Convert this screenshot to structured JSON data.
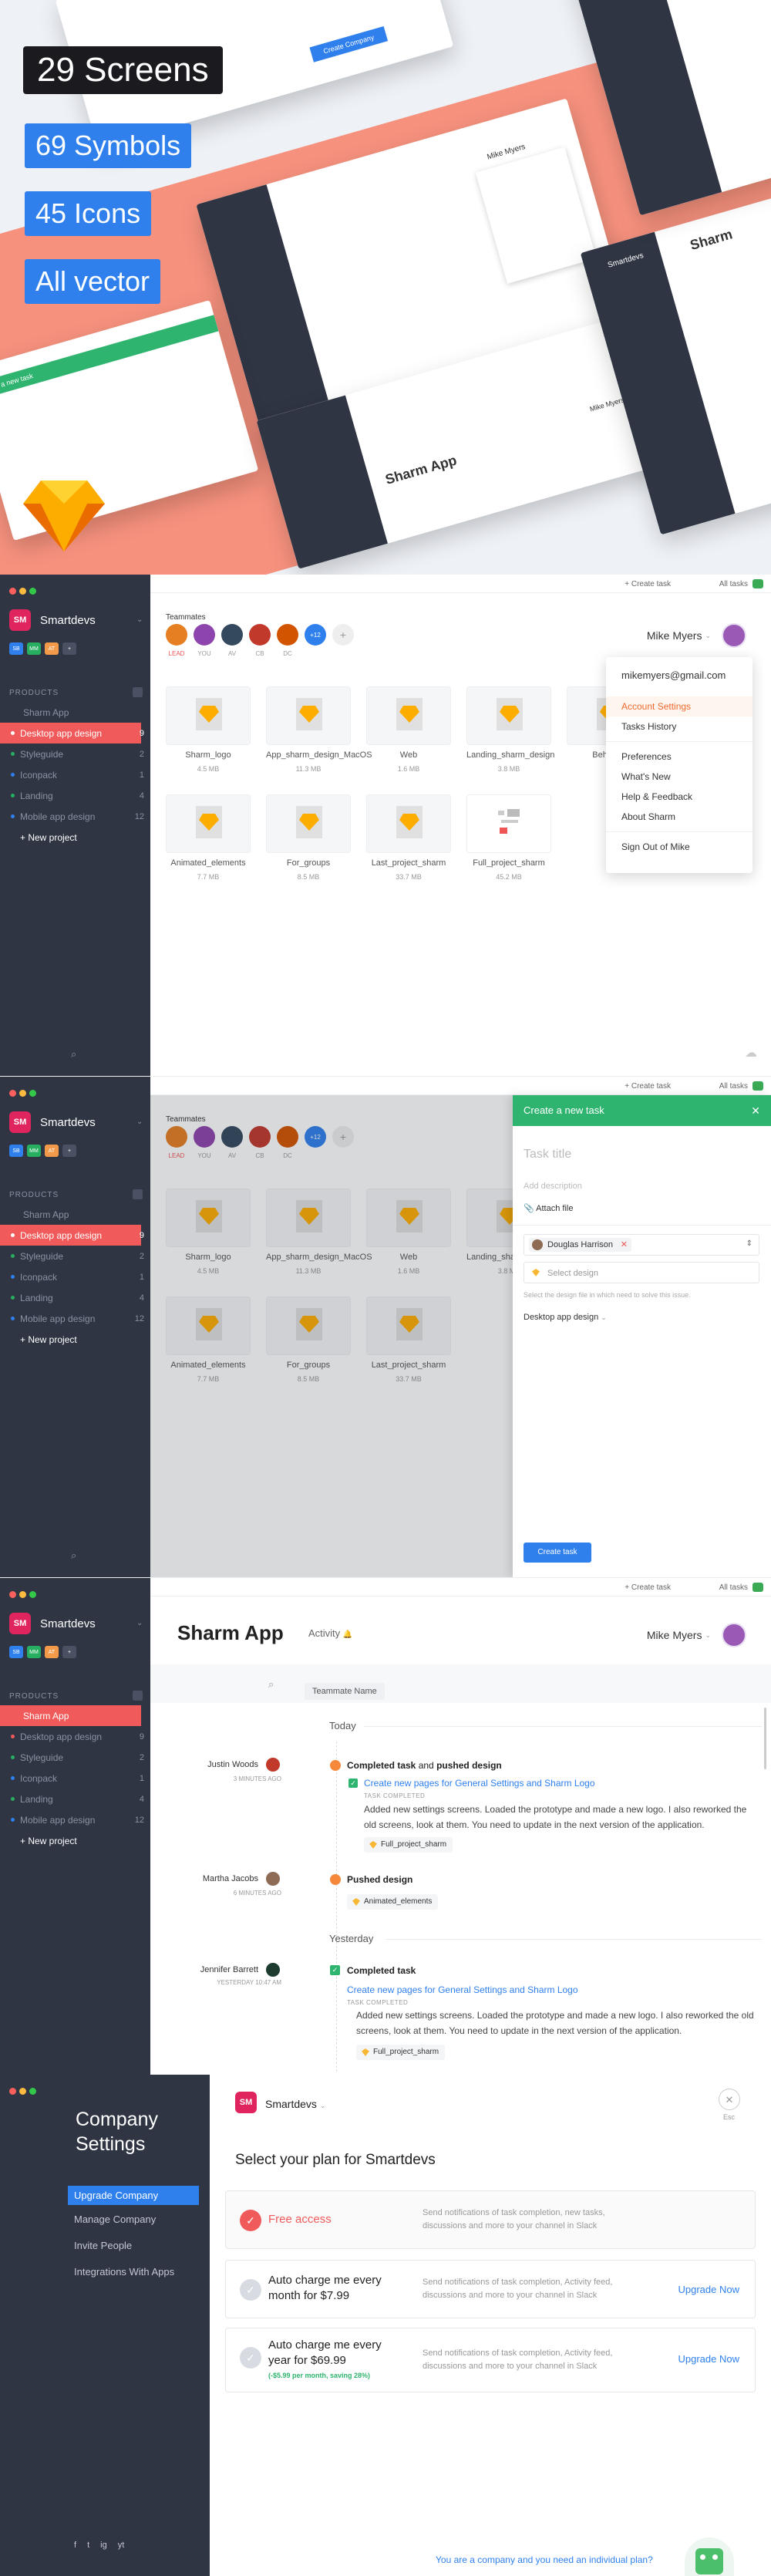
{
  "hero": {
    "screens": "29 Screens",
    "symbols": "69 Symbols",
    "icons": "45 Icons",
    "vector": "All vector",
    "mock_app": "Sharm App",
    "mock_user": "Mike Myers",
    "mock_ws": "Smartdevs",
    "mock_create": "Create Company",
    "mock_new": "Create a new task",
    "mock_sharm": "Sharm"
  },
  "app": {
    "workspace": "Smartdevs",
    "logo": "SM",
    "badges": [
      "SB",
      "MM",
      "AT",
      "+"
    ],
    "products_label": "PRODUCTS",
    "folder": "Sharm App",
    "items": [
      {
        "label": "Desktop app design",
        "count": "9"
      },
      {
        "label": "Styleguide",
        "count": "2"
      },
      {
        "label": "Iconpack",
        "count": "1"
      },
      {
        "label": "Landing",
        "count": "4"
      },
      {
        "label": "Mobile app design",
        "count": "12"
      }
    ],
    "new_project": "+ New project",
    "create_task": "+ Create task",
    "all_tasks": "All tasks",
    "all_tasks_count": "4",
    "teammates": "Teammates",
    "team": [
      {
        "label": "LEAD",
        "color": "#e67e22"
      },
      {
        "label": "YOU",
        "color": "#8e44ad"
      },
      {
        "label": "AV",
        "color": "#34495e"
      },
      {
        "label": "CB",
        "color": "#c0392b"
      },
      {
        "label": "DC",
        "color": "#d35400"
      },
      {
        "label": "+12",
        "color": "#2f80ed"
      }
    ],
    "user": "Mike Myers",
    "files": [
      {
        "name": "Sharm_logo",
        "size": "4.5 MB"
      },
      {
        "name": "App_sharm_design_MacOS",
        "size": "11.3 MB"
      },
      {
        "name": "Web",
        "size": "1.6 MB"
      },
      {
        "name": "Landing_sharm_design",
        "size": "3.8 MB"
      },
      {
        "name": "Behance",
        "size": ""
      },
      {
        "name": "Animated_elements",
        "size": "7.7 MB"
      },
      {
        "name": "For_groups",
        "size": "8.5 MB"
      },
      {
        "name": "Last_project_sharm",
        "size": "33.7 MB"
      },
      {
        "name": "Full_project_sharm",
        "size": "45.2 MB"
      }
    ],
    "sketch_label": "SKETCH",
    "menu": {
      "email": "mikemyers@gmail.com",
      "items": [
        "Account Settings",
        "Tasks History",
        "Preferences",
        "What's New",
        "Help & Feedback",
        "About Sharm",
        "Sign Out of Mike"
      ]
    }
  },
  "task_modal": {
    "title": "Create a new task",
    "task_title_ph": "Task title",
    "desc_ph": "Add description",
    "attach": "Attach file",
    "assignee": "Douglas Harrison",
    "select_design": "Select design",
    "hint": "Select the design file in which need to solve this issue.",
    "project": "Desktop app design",
    "create": "Create task"
  },
  "activity": {
    "app_title": "Sharm App",
    "tab": "Activity",
    "teammate_filter": "Teammate Name",
    "today": "Today",
    "yesterday": "Yesterday",
    "e1_who": "Justin Woods",
    "e1_ago": "3 MINUTES AGO",
    "e1_action": "Completed task",
    "e1_and": "and",
    "e1_action2": "pushed design",
    "e1_link": "Create new pages for General Settings and Sharm Logo",
    "e1_tc": "TASK COMPLETED",
    "e1_body": "Added new settings screens. Loaded the prototype and made a new logo. I also reworked the old screens, look at them. You need to update in the next version of the application.",
    "e1_file": "Full_project_sharm",
    "e2_who": "Martha Jacobs",
    "e2_ago": "6 MINUTES AGO",
    "e2_action": "Pushed design",
    "e2_file": "Animated_elements",
    "e3_who": "Jennifer Barrett",
    "e3_ago": "YESTERDAY 10:47 AM",
    "e3_action": "Completed task",
    "e3_link": "Create new pages for General Settings and Sharm Logo",
    "e3_tc": "TASK COMPLETED",
    "e3_body": "Added new settings screens. Loaded the prototype and made a new logo. I also reworked the old screens, look at them. You need to update in the next version of the application.",
    "e3_file": "Full_project_sharm"
  },
  "settings": {
    "title": "Company Settings",
    "nav": [
      "Upgrade Company",
      "Manage Company",
      "Invite People",
      "Integrations With Apps"
    ],
    "workspace": "Smartdevs",
    "esc": "Esc",
    "heading": "Select your plan for Smartdevs",
    "plans": [
      {
        "title": "Free access",
        "desc": "Send notifications of task completion, new tasks, discussions and more to your channel in Slack",
        "cta": ""
      },
      {
        "title": "Auto charge me every month for $7.99",
        "desc": "Send notifications of task completion, Activity feed, discussions and more to your channel in Slack",
        "cta": "Upgrade Now"
      },
      {
        "title": "Auto charge me every year for $69.99",
        "sub": "(-$5.99 per month, saving 28%)",
        "desc": "Send notifications of task completion, Activity feed, discussions and more to your channel in Slack",
        "cta": "Upgrade Now"
      }
    ],
    "footer": "You are a company and you need an individual plan?",
    "social": [
      "f",
      "t",
      "ig",
      "yt"
    ]
  },
  "colors": {
    "sidebar": "#2f3543",
    "accent": "#f05a5a",
    "green": "#2fb46f",
    "blue": "#2f80ed",
    "coral": "#f6917e"
  }
}
